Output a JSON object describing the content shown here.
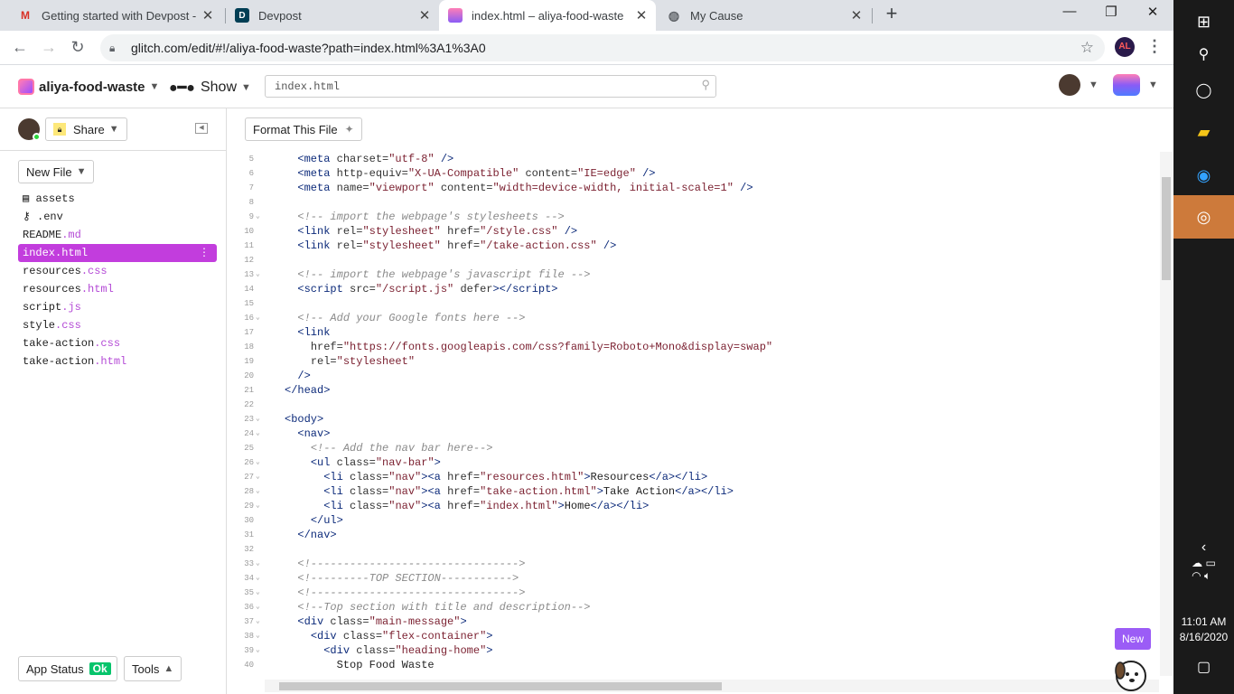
{
  "tabs": [
    {
      "title": "Getting started with Devpost - pu",
      "icon": "gmail-icon",
      "active": false
    },
    {
      "title": "Devpost",
      "icon": "devpost-icon",
      "active": false
    },
    {
      "title": "index.html – aliya-food-waste",
      "icon": "glitch-icon",
      "active": true
    },
    {
      "title": "My Cause",
      "icon": "globe-icon",
      "active": false
    }
  ],
  "address": "glitch.com/edit/#!/aliya-food-waste?path=index.html%3A1%3A0",
  "profile_initials": "AL",
  "project_name": "aliya-food-waste",
  "show_label": "Show",
  "search_value": "index.html",
  "share_label": "Share",
  "new_file_label": "New File",
  "files": [
    {
      "name": "assets",
      "ext": "",
      "icon": "assets-icon"
    },
    {
      "name": ".env",
      "ext": "",
      "icon": "key-icon"
    },
    {
      "name": "README",
      "ext": ".md"
    },
    {
      "name": "index",
      "ext": ".html",
      "active": true
    },
    {
      "name": "resources",
      "ext": ".css"
    },
    {
      "name": "resources",
      "ext": ".html"
    },
    {
      "name": "script",
      "ext": ".js"
    },
    {
      "name": "style",
      "ext": ".css"
    },
    {
      "name": "take-action",
      "ext": ".css"
    },
    {
      "name": "take-action",
      "ext": ".html"
    }
  ],
  "app_status_label": "App Status",
  "app_status_value": "Ok",
  "tools_label": "Tools",
  "format_label": "Format This File",
  "new_badge": "New",
  "code_lines": [
    {
      "n": "5",
      "fold": "",
      "html": "  <span class='tag'>&lt;meta</span> <span class='attr'>charset=</span><span class='str'>\"utf-8\"</span> <span class='tag'>/&gt;</span>"
    },
    {
      "n": "6",
      "fold": "",
      "html": "  <span class='tag'>&lt;meta</span> <span class='attr'>http-equiv=</span><span class='str'>\"X-UA-Compatible\"</span> <span class='attr'>content=</span><span class='str'>\"IE=edge\"</span> <span class='tag'>/&gt;</span>"
    },
    {
      "n": "7",
      "fold": "",
      "html": "  <span class='tag'>&lt;meta</span> <span class='attr'>name=</span><span class='str'>\"viewport\"</span> <span class='attr'>content=</span><span class='str'>\"width=device-width, initial-scale=1\"</span> <span class='tag'>/&gt;</span>"
    },
    {
      "n": "8",
      "fold": "",
      "html": ""
    },
    {
      "n": "9",
      "fold": "v",
      "html": "  <span class='cmt'>&lt;!-- import the webpage's stylesheets --&gt;</span>"
    },
    {
      "n": "10",
      "fold": "",
      "html": "  <span class='tag'>&lt;link</span> <span class='attr'>rel=</span><span class='str'>\"stylesheet\"</span> <span class='attr'>href=</span><span class='str'>\"/style.css\"</span> <span class='tag'>/&gt;</span>"
    },
    {
      "n": "11",
      "fold": "",
      "html": "  <span class='tag'>&lt;link</span> <span class='attr'>rel=</span><span class='str'>\"stylesheet\"</span> <span class='attr'>href=</span><span class='str'>\"/take-action.css\"</span> <span class='tag'>/&gt;</span>"
    },
    {
      "n": "12",
      "fold": "",
      "html": ""
    },
    {
      "n": "13",
      "fold": "v",
      "html": "  <span class='cmt'>&lt;!-- import the webpage's javascript file --&gt;</span>"
    },
    {
      "n": "14",
      "fold": "",
      "html": "  <span class='tag'>&lt;script</span> <span class='attr'>src=</span><span class='str'>\"/script.js\"</span> <span class='attr'>defer</span><span class='tag'>&gt;&lt;/script&gt;</span>"
    },
    {
      "n": "15",
      "fold": "",
      "html": ""
    },
    {
      "n": "16",
      "fold": "v",
      "html": "  <span class='cmt'>&lt;!-- Add your Google fonts here --&gt;</span>"
    },
    {
      "n": "17",
      "fold": "",
      "html": "  <span class='tag'>&lt;link</span>"
    },
    {
      "n": "18",
      "fold": "",
      "html": "    <span class='attr'>href=</span><span class='str'>\"https://fonts.googleapis.com/css?family=Roboto+Mono&amp;display=swap\"</span>"
    },
    {
      "n": "19",
      "fold": "",
      "html": "    <span class='attr'>rel=</span><span class='str'>\"stylesheet\"</span>"
    },
    {
      "n": "20",
      "fold": "",
      "html": "  <span class='tag'>/&gt;</span>"
    },
    {
      "n": "21",
      "fold": "",
      "html": "<span class='tag'>&lt;/head&gt;</span>"
    },
    {
      "n": "22",
      "fold": "",
      "html": ""
    },
    {
      "n": "23",
      "fold": "v",
      "html": "<span class='tag'>&lt;body&gt;</span>"
    },
    {
      "n": "24",
      "fold": "v",
      "html": "  <span class='tag'>&lt;nav&gt;</span>"
    },
    {
      "n": "25",
      "fold": "",
      "html": "    <span class='cmt'>&lt;!-- Add the nav bar here--&gt;</span>"
    },
    {
      "n": "26",
      "fold": "v",
      "html": "    <span class='tag'>&lt;ul</span> <span class='attr'>class=</span><span class='str'>\"nav-bar\"</span><span class='tag'>&gt;</span>"
    },
    {
      "n": "27",
      "fold": "v",
      "html": "      <span class='tag'>&lt;li</span> <span class='attr'>class=</span><span class='str'>\"nav\"</span><span class='tag'>&gt;&lt;a</span> <span class='attr'>href=</span><span class='str'>\"resources.html\"</span><span class='tag'>&gt;</span>Resources<span class='tag'>&lt;/a&gt;&lt;/li&gt;</span>"
    },
    {
      "n": "28",
      "fold": "v",
      "html": "      <span class='tag'>&lt;li</span> <span class='attr'>class=</span><span class='str'>\"nav\"</span><span class='tag'>&gt;&lt;a</span> <span class='attr'>href=</span><span class='str'>\"take-action.html\"</span><span class='tag'>&gt;</span>Take Action<span class='tag'>&lt;/a&gt;&lt;/li&gt;</span>"
    },
    {
      "n": "29",
      "fold": "v",
      "html": "      <span class='tag'>&lt;li</span> <span class='attr'>class=</span><span class='str'>\"nav\"</span><span class='tag'>&gt;&lt;a</span> <span class='attr'>href=</span><span class='str'>\"index.html\"</span><span class='tag'>&gt;</span>Home<span class='tag'>&lt;/a&gt;&lt;/li&gt;</span>"
    },
    {
      "n": "30",
      "fold": "",
      "html": "    <span class='tag'>&lt;/ul&gt;</span>"
    },
    {
      "n": "31",
      "fold": "",
      "html": "  <span class='tag'>&lt;/nav&gt;</span>"
    },
    {
      "n": "32",
      "fold": "",
      "html": ""
    },
    {
      "n": "33",
      "fold": "v",
      "html": "  <span class='cmt'>&lt;!--------------------------------&gt;</span>"
    },
    {
      "n": "34",
      "fold": "v",
      "html": "  <span class='cmt'>&lt;!---------TOP SECTION-----------&gt;</span>"
    },
    {
      "n": "35",
      "fold": "v",
      "html": "  <span class='cmt'>&lt;!--------------------------------&gt;</span>"
    },
    {
      "n": "36",
      "fold": "v",
      "html": "  <span class='cmt'>&lt;!--Top section with title and description--&gt;</span>"
    },
    {
      "n": "37",
      "fold": "v",
      "html": "  <span class='tag'>&lt;div</span> <span class='attr'>class=</span><span class='str'>\"main-message\"</span><span class='tag'>&gt;</span>"
    },
    {
      "n": "38",
      "fold": "v",
      "html": "    <span class='tag'>&lt;div</span> <span class='attr'>class=</span><span class='str'>\"flex-container\"</span><span class='tag'>&gt;</span>"
    },
    {
      "n": "39",
      "fold": "v",
      "html": "      <span class='tag'>&lt;div</span> <span class='attr'>class=</span><span class='str'>\"heading-home\"</span><span class='tag'>&gt;</span>"
    },
    {
      "n": "40",
      "fold": "",
      "html": "        Stop Food Waste"
    }
  ],
  "clock_time": "11:01 AM",
  "clock_date": "8/16/2020"
}
